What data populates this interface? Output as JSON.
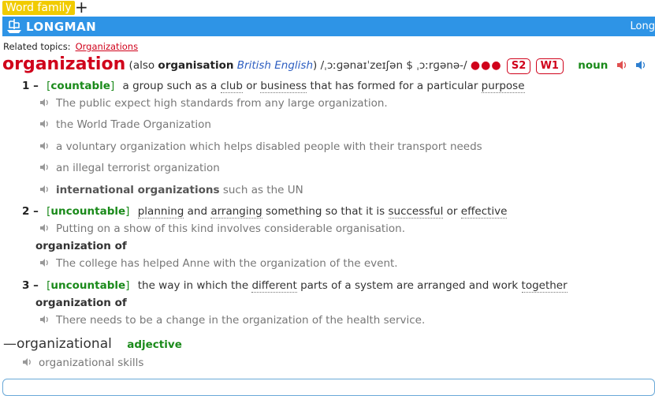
{
  "tab": {
    "label": "Word family",
    "add_label": "+"
  },
  "header": {
    "brand": "LONGMAN",
    "right_text": "Long"
  },
  "related": {
    "label": "Related topics:",
    "link": "Organizations"
  },
  "entry": {
    "headword": "organization",
    "also_open": "(also ",
    "also_word": "organisation",
    "also_region": "British English",
    "pron": ") /ˌɔːɡənaɪˈzeɪʃən $ ˌɔːrɡənə-/",
    "dots": "●●●",
    "freq_s": "S2",
    "freq_w": "W1",
    "pos": "noun"
  },
  "senses": [
    {
      "num": "1 –",
      "gram": "countable",
      "def_parts": [
        "a group such as a ",
        "club",
        " or ",
        "business",
        " that has formed for a particular ",
        "purpose"
      ],
      "examples": [
        "The public expect high standards from any large organization.",
        "the World Trade Organization",
        "a voluntary organization which helps disabled people with their transport needs",
        "an illegal terrorist organization"
      ],
      "colloc_example": {
        "bold": "international organizations",
        "rest": " such as the UN"
      }
    },
    {
      "num": "2 –",
      "gram": "uncountable",
      "def_parts": [
        "planning",
        " and ",
        "arranging",
        " something so that it is ",
        "successful",
        " or ",
        "effective"
      ],
      "examples": [
        "Putting on a show of this kind involves considerable organisation."
      ],
      "colloc": "organization of",
      "colloc_examples": [
        "The college has helped Anne with the organization of the event."
      ]
    },
    {
      "num": "3 –",
      "gram": "uncountable",
      "def_parts": [
        "the way in which the ",
        "different",
        " parts of a system are arranged and work ",
        "together"
      ],
      "colloc": "organization of",
      "colloc_examples": [
        "There needs to be a change in the organization of the health service."
      ]
    }
  ],
  "derived": {
    "word": "—organizational",
    "pos": "adjective",
    "example": "organizational skills"
  },
  "colors": {
    "header_bg": "#2e94e6",
    "tab_bg": "#f1cb00",
    "headword": "#d0021b",
    "grammar": "#1a8a1a"
  },
  "icons": {
    "speaker_red": "speaker-uk-icon",
    "speaker_blue": "speaker-us-icon",
    "speaker_gray": "speaker-icon",
    "logo": "ship-logo-icon"
  }
}
